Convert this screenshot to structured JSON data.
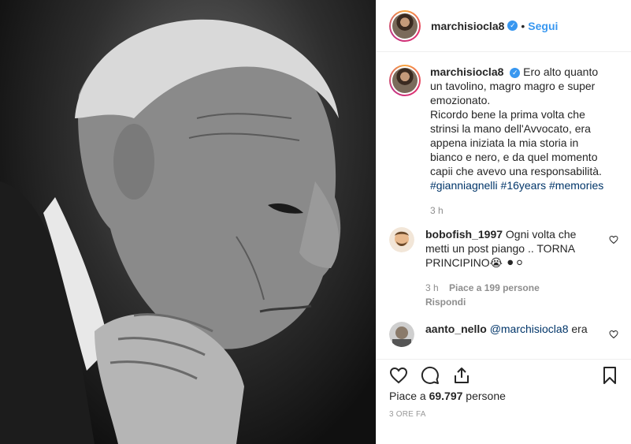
{
  "post": {
    "username": "marchisiocla8",
    "verified_mark": "✓",
    "separator": "•",
    "follow_label": "Segui"
  },
  "caption": {
    "username": "marchisiocla8",
    "text_1": "Ero alto quanto un tavolino, magro magro e super emozionato.",
    "text_2": "Ricordo bene la prima volta che strinsi la mano dell'Avvocato, era appena iniziata la mia storia in bianco e nero, e da quel momento capii che avevo una responsabilità.",
    "tags": [
      "#gianniagnelli",
      "#16years",
      "#memories"
    ],
    "age": "3 h"
  },
  "comments": [
    {
      "username": "bobofish_1997",
      "text": "Ogni volta che metti un post piango .. TORNA PRINCIPINO😭 ⚫⚪",
      "age": "3 h",
      "likes": "Piace a 199 persone",
      "reply_label": "Rispondi"
    },
    {
      "username": "aanto_nello",
      "mention": "@marchisiocla8",
      "text": "era"
    }
  ],
  "footer": {
    "likes_prefix": "Piace a ",
    "likes_count": "69.797",
    "likes_suffix": " persone",
    "timestamp": "3 ORE FA"
  },
  "icons": {
    "like": "heart-icon",
    "comment": "comment-icon",
    "share": "share-icon",
    "save": "bookmark-icon"
  },
  "colors": {
    "link": "#3897f0",
    "hashtag": "#003569",
    "muted": "#8e8e8e"
  }
}
